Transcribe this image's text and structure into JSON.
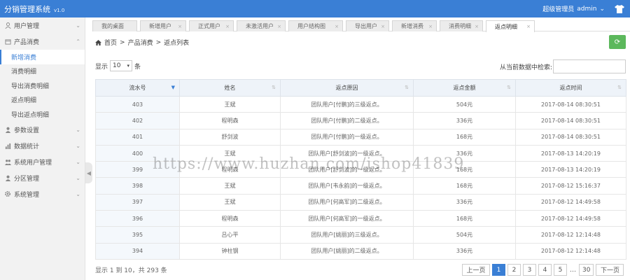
{
  "header": {
    "title": "分销管理系统",
    "version": "v1.0",
    "role": "超级管理员",
    "username": "admin",
    "caret": "⌄"
  },
  "sidebar": {
    "groups": [
      {
        "label": "用户管理",
        "icon": "user-icon",
        "chevron": "⌄"
      },
      {
        "label": "产品消费",
        "icon": "box-icon",
        "chevron": "⌃"
      },
      {
        "label": "参数设置",
        "icon": "user-icon",
        "chevron": "⌄"
      },
      {
        "label": "数据统计",
        "icon": "chart-icon",
        "chevron": "⌄"
      },
      {
        "label": "系统用户管理",
        "icon": "group-icon",
        "chevron": "⌄"
      },
      {
        "label": "分区管理",
        "icon": "user-icon",
        "chevron": "⌄"
      },
      {
        "label": "系统管理",
        "icon": "gear-icon",
        "chevron": "⌄"
      }
    ],
    "sub_items": [
      "新增消费",
      "消费明细",
      "导出消费明细",
      "返点明细",
      "导出返点明细"
    ]
  },
  "tabs": [
    {
      "label": "我的桌面"
    },
    {
      "label": "新增用户",
      "close": "×"
    },
    {
      "label": "正式用户",
      "close": "×"
    },
    {
      "label": "未激活用户",
      "close": "×"
    },
    {
      "label": "用户结构图",
      "close": "×"
    },
    {
      "label": "导出用户",
      "close": "×"
    },
    {
      "label": "新增消费",
      "close": "×"
    },
    {
      "label": "消费明细",
      "close": "×"
    },
    {
      "label": "返点明细",
      "close": "×"
    }
  ],
  "breadcrumb": {
    "home": "首页",
    "sep": ">",
    "level1": "产品消费",
    "level2": "返点列表"
  },
  "refresh_icon": "⟳",
  "table_controls": {
    "show_label": "显示",
    "length_value": "10",
    "unit_label": "条",
    "search_label": "从当前数据中检索:",
    "search_value": ""
  },
  "table": {
    "columns": [
      "流水号",
      "姓名",
      "返点原因",
      "返点金额",
      "返点时间"
    ],
    "sort_asc_desc": "⇅",
    "sort_desc": "▼",
    "rows": [
      [
        "403",
        "王斌",
        "团队用户[付鹏]的三级返点。",
        "504元",
        "2017-08-14 08:30:51"
      ],
      [
        "402",
        "程明森",
        "团队用户[付鹏]的二级返点。",
        "336元",
        "2017-08-14 08:30:51"
      ],
      [
        "401",
        "舒剑波",
        "团队用户[付鹏]的一级返点。",
        "168元",
        "2017-08-14 08:30:51"
      ],
      [
        "400",
        "王斌",
        "团队用户[舒剑波]的一级返点。",
        "336元",
        "2017-08-13 14:20:19"
      ],
      [
        "399",
        "程明森",
        "团队用户[舒剑波]的一级返点。",
        "168元",
        "2017-08-13 14:20:19"
      ],
      [
        "398",
        "王斌",
        "团队用户[韦永韵]的一级返点。",
        "168元",
        "2017-08-12 15:16:37"
      ],
      [
        "397",
        "王斌",
        "团队用户[何高军]的二级返点。",
        "336元",
        "2017-08-12 14:49:58"
      ],
      [
        "396",
        "程明森",
        "团队用户[何高军]的一级返点。",
        "168元",
        "2017-08-12 14:49:58"
      ],
      [
        "395",
        "吕心平",
        "团队用户[姚丽]的三级返点。",
        "504元",
        "2017-08-12 12:14:48"
      ],
      [
        "394",
        "钟柱钢",
        "团队用户[姚丽]的二级返点。",
        "336元",
        "2017-08-12 12:14:48"
      ]
    ]
  },
  "footer": {
    "info": "显示 1 到 10，共 293 条"
  },
  "pagination": {
    "prev": "上一页",
    "pages": [
      "1",
      "2",
      "3",
      "4",
      "5"
    ],
    "dots": "…",
    "last": "30",
    "next": "下一页"
  },
  "watermark": "https://www.huzhan.com/ishop41839"
}
